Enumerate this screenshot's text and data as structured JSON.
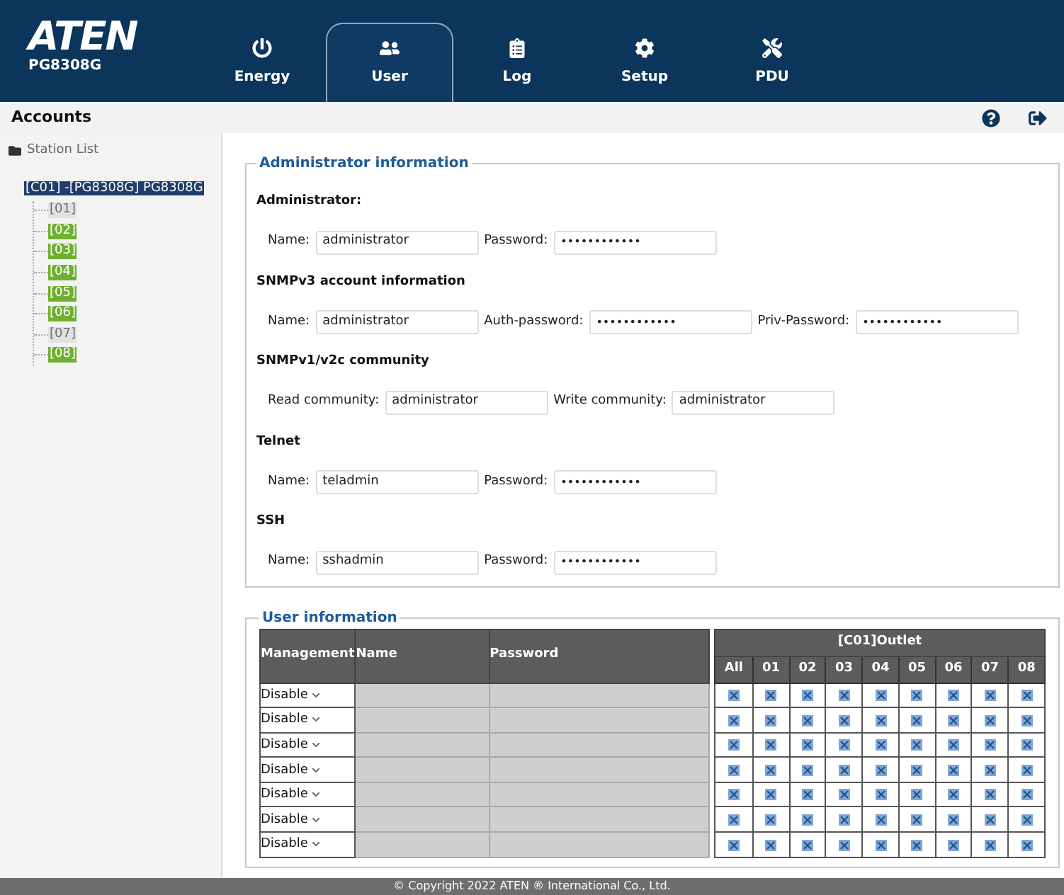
{
  "brand": {
    "logo": "ATEN",
    "model": "PG8308G"
  },
  "tabs": [
    {
      "label": "Energy",
      "selected": false
    },
    {
      "label": "User",
      "selected": true
    },
    {
      "label": "Log",
      "selected": false
    },
    {
      "label": "Setup",
      "selected": false
    },
    {
      "label": "PDU",
      "selected": false
    }
  ],
  "page_title": "Accounts",
  "sidebar": {
    "root": "Station List",
    "station": {
      "label": "[C01] -[PG8308G] PG8308G",
      "selected": true,
      "children": [
        {
          "label": "[01]",
          "online": false
        },
        {
          "label": "[02]",
          "online": true
        },
        {
          "label": "[03]",
          "online": true
        },
        {
          "label": "[04]",
          "online": true
        },
        {
          "label": "[05]",
          "online": true
        },
        {
          "label": "[06]",
          "online": true
        },
        {
          "label": "[07]",
          "online": false
        },
        {
          "label": "[08]",
          "online": true
        }
      ]
    }
  },
  "admin_section": {
    "title": "Administrator information",
    "groups": [
      {
        "heading": "Administrator:",
        "fields": [
          {
            "label": "Name:",
            "value": "administrator",
            "kind": "text"
          },
          {
            "label": "Password:",
            "value": "••••••••••••",
            "kind": "password"
          }
        ]
      },
      {
        "heading": "SNMPv3 account information",
        "fields": [
          {
            "label": "Name:",
            "value": "administrator",
            "kind": "text"
          },
          {
            "label": "Auth-password:",
            "value": "••••••••••••",
            "kind": "password"
          },
          {
            "label": "Priv-Password:",
            "value": "••••••••••••",
            "kind": "password"
          }
        ]
      },
      {
        "heading": "SNMPv1/v2c community",
        "fields": [
          {
            "label": "Read community:",
            "value": "administrator",
            "kind": "text"
          },
          {
            "label": "Write community:",
            "value": "administrator",
            "kind": "text"
          }
        ]
      },
      {
        "heading": "Telnet",
        "fields": [
          {
            "label": "Name:",
            "value": "teladmin",
            "kind": "text"
          },
          {
            "label": "Password:",
            "value": "••••••••••••",
            "kind": "password"
          }
        ]
      },
      {
        "heading": "SSH",
        "fields": [
          {
            "label": "Name:",
            "value": "sshadmin",
            "kind": "text"
          },
          {
            "label": "Password:",
            "value": "••••••••••••",
            "kind": "password"
          }
        ]
      }
    ]
  },
  "user_section": {
    "title": "User information",
    "columns": [
      "Management",
      "Name",
      "Password"
    ],
    "outlet_group": "[C01]Outlet",
    "outlet_columns": [
      "All",
      "01",
      "02",
      "03",
      "04",
      "05",
      "06",
      "07",
      "08"
    ],
    "rows": [
      {
        "management": "Disable",
        "disabled": true
      },
      {
        "management": "Disable",
        "disabled": true
      },
      {
        "management": "Disable",
        "disabled": true
      },
      {
        "management": "Disable",
        "disabled": true
      },
      {
        "management": "Disable",
        "disabled": true
      },
      {
        "management": "Disable",
        "disabled": true
      },
      {
        "management": "Disable",
        "disabled": true
      }
    ]
  },
  "footer": "© Copyright 2022 ATEN ® International Co., Ltd."
}
